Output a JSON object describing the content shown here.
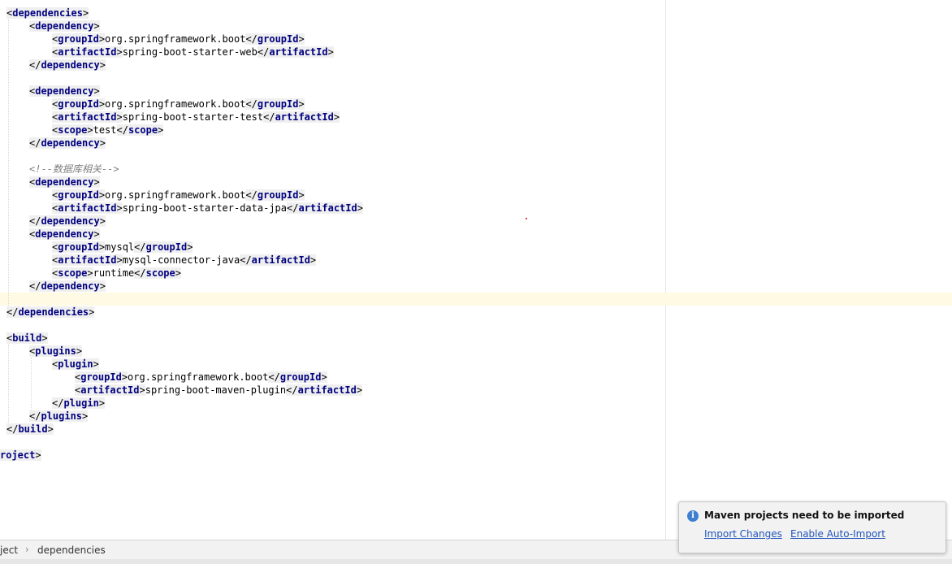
{
  "editor": {
    "lines": [
      {
        "text": "<dependencies>"
      },
      {
        "text": "<dependency>"
      },
      {
        "text": "<groupId>org.springframework.boot</groupId>"
      },
      {
        "text": "<artifactId>spring-boot-starter-web</artifactId>"
      },
      {
        "text": "</dependency>"
      },
      {
        "text": ""
      },
      {
        "text": "<dependency>"
      },
      {
        "text": "<groupId>org.springframework.boot</groupId>"
      },
      {
        "text": "<artifactId>spring-boot-starter-test</artifactId>"
      },
      {
        "text": "<scope>test</scope>"
      },
      {
        "text": "</dependency>"
      },
      {
        "text": ""
      },
      {
        "text": "<!--数据库相关-->"
      },
      {
        "text": "<dependency>"
      },
      {
        "text": "<groupId>org.springframework.boot</groupId>"
      },
      {
        "text": "<artifactId>spring-boot-starter-data-jpa</artifactId>"
      },
      {
        "text": "</dependency>"
      },
      {
        "text": "<dependency>"
      },
      {
        "text": "<groupId>mysql</groupId>"
      },
      {
        "text": "<artifactId>mysql-connector-java</artifactId>"
      },
      {
        "text": "<scope>runtime</scope>"
      },
      {
        "text": "</dependency>"
      },
      {
        "text": ""
      },
      {
        "text": "</dependencies>"
      },
      {
        "text": ""
      },
      {
        "text": "<build>"
      },
      {
        "text": "<plugins>"
      },
      {
        "text": "<plugin>"
      },
      {
        "text": "<groupId>org.springframework.boot</groupId>"
      },
      {
        "text": "<artifactId>spring-boot-maven-plugin</artifactId>"
      },
      {
        "text": "</plugin>"
      },
      {
        "text": "</plugins>"
      },
      {
        "text": "</build>"
      },
      {
        "text": ""
      },
      {
        "text": "roject>"
      }
    ]
  },
  "breadcrumb": {
    "items": [
      "ject",
      "dependencies"
    ]
  },
  "notification": {
    "title": "Maven projects need to be imported",
    "import_changes": "Import Changes",
    "enable_auto_import": "Enable Auto-Import"
  }
}
